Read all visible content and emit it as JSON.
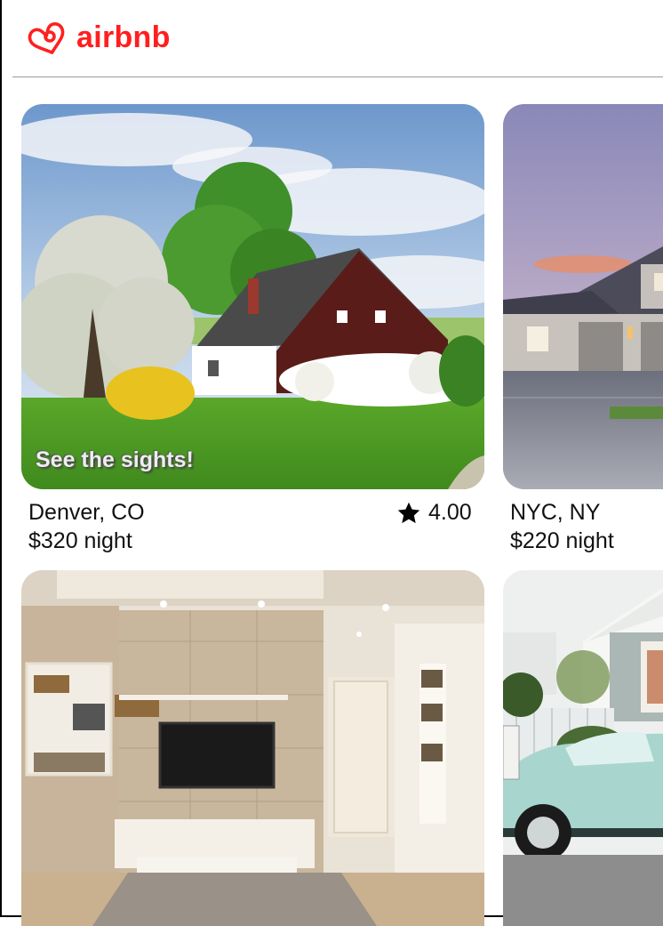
{
  "brand": {
    "name": "airbnb",
    "color": "#ff1f1f",
    "logo_icon": "airbnb-belo-icon"
  },
  "listings": [
    {
      "city": "Denver, CO",
      "price": "$320 night",
      "rating": "4.00",
      "caption": "See the sights!",
      "image": "countryside-cottage-photo",
      "rating_icon": "star-icon"
    },
    {
      "city": "NYC, NY",
      "price": "$220 night",
      "image": "suburban-house-garage-photo"
    },
    {
      "image": "living-room-tv-wall-photo"
    },
    {
      "image": "white-house-vintage-car-photo"
    }
  ]
}
